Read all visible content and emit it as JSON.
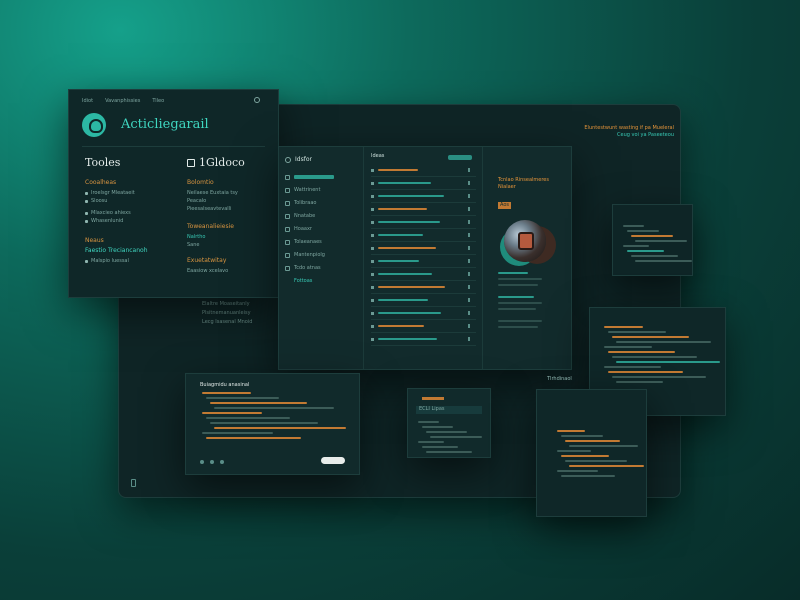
{
  "main_window": {
    "header_title": "Eluntestwunt wasting if pa Mueleral",
    "header_sub": "Ceug voi ya Paseeteou"
  },
  "tools_card": {
    "nav": [
      "Idiot",
      "Vavanphissies",
      "Tileo"
    ],
    "brand": "Acticliegarail",
    "left": {
      "heading": "Tooles",
      "section1": "Cooalheas",
      "items1": [
        "Iroelsgr Mleataeit",
        "Sloosu",
        "Mlaxcieo ahiexs",
        "Whasenlunid"
      ],
      "section2": "Neaus",
      "section2b": "Faestio Treciancanoh",
      "items2": [
        "Malspio luessal"
      ]
    },
    "right": {
      "heading": "1Gldoco",
      "section1": "Bolomtio",
      "items1": [
        "Neilaese Euxtaia tsy",
        "Peacalo",
        "Pieesalseavtevalli"
      ],
      "section2": "Toweanalieiesie",
      "items2": [
        "Nalrtho",
        "Sane"
      ],
      "section3": "Exuetatwitay",
      "items3": [
        "Eaasiow xcelavo"
      ]
    }
  },
  "floating_text": [
    "Elaltre Moaseitanly",
    "Plsitnemanuanleisy",
    "Lecg Isasenal Mnoid"
  ],
  "app": {
    "side_title": "Idsfor",
    "side_items": [
      "Wattrinent",
      "Tolibraao",
      "Nnatabe",
      "Hoaaxr",
      "Tolaeanaes",
      "Mantenpiolg",
      "Tcdo atnas",
      "Fottoas"
    ],
    "list_header": "Ideas",
    "list_count": 14,
    "detail_title": "Tcnlao Rinsealmeres Nialaer",
    "detail_tag": "Aos"
  },
  "code_left": {
    "title": "Buiagmidu anasinal"
  },
  "code_mid": {
    "title": "Iteieatls",
    "tag": "ECLI Lipas"
  },
  "code_right": {
    "title": "Tlrhdinaol"
  },
  "colors": {
    "accent": "#38c9b5",
    "orange": "#e5943a",
    "panel": "#102a2a"
  }
}
